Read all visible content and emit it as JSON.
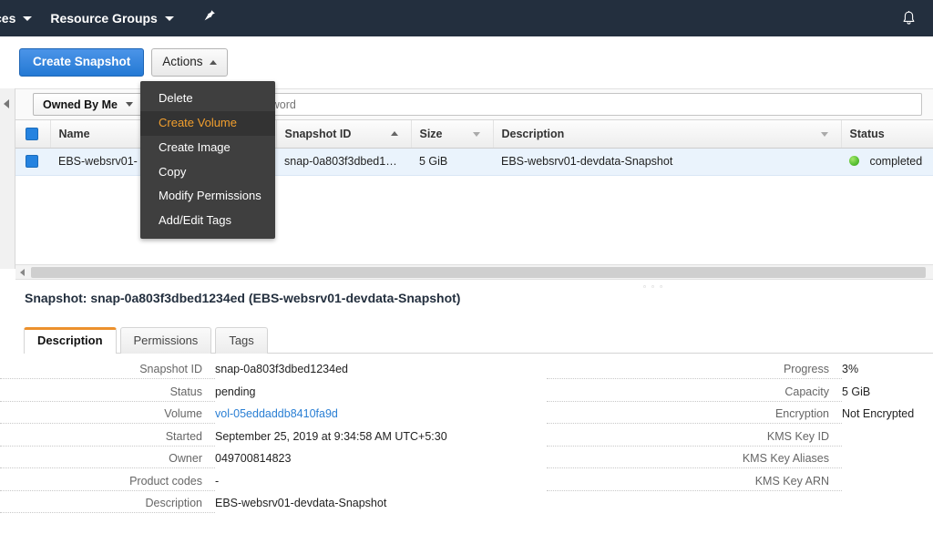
{
  "topnav": {
    "services_label": "ces",
    "resource_groups_label": "Resource Groups",
    "pin_icon": "pin-icon",
    "bell_icon": "bell-icon"
  },
  "toolbar": {
    "create_snapshot_label": "Create Snapshot",
    "actions_label": "Actions"
  },
  "filterbar": {
    "owner_filter_value": "Owned By Me",
    "search_placeholder": "butes or search by keyword"
  },
  "actions_menu": {
    "items": [
      {
        "label": "Delete",
        "highlighted": false
      },
      {
        "label": "Create Volume",
        "highlighted": true
      },
      {
        "label": "Create Image",
        "highlighted": false
      },
      {
        "label": "Copy",
        "highlighted": false
      },
      {
        "label": "Modify Permissions",
        "highlighted": false
      },
      {
        "label": "Add/Edit Tags",
        "highlighted": false
      }
    ]
  },
  "table": {
    "columns": [
      "Name",
      "Snapshot ID",
      "Size",
      "Description",
      "Status"
    ],
    "rows": [
      {
        "name": "EBS-websrv01-",
        "snapshot_id": "snap-0a803f3dbed1…",
        "size": "5 GiB",
        "description": "EBS-websrv01-devdata-Snapshot",
        "status": "completed"
      }
    ]
  },
  "detail": {
    "title": "Snapshot: snap-0a803f3dbed1234ed (EBS-websrv01-devdata-Snapshot)",
    "tabs": [
      {
        "label": "Description",
        "active": true
      },
      {
        "label": "Permissions",
        "active": false
      },
      {
        "label": "Tags",
        "active": false
      }
    ],
    "left_fields": [
      {
        "label": "Snapshot ID",
        "value": "snap-0a803f3dbed1234ed",
        "link": false
      },
      {
        "label": "Status",
        "value": "pending",
        "link": false
      },
      {
        "label": "Volume",
        "value": "vol-05eddaddb8410fa9d",
        "link": true
      },
      {
        "label": "Started",
        "value": "September 25, 2019 at 9:34:58 AM UTC+5:30",
        "link": false
      },
      {
        "label": "Owner",
        "value": "049700814823",
        "link": false
      },
      {
        "label": "Product codes",
        "value": "-",
        "link": false
      },
      {
        "label": "Description",
        "value": "EBS-websrv01-devdata-Snapshot",
        "link": false
      }
    ],
    "right_fields": [
      {
        "label": "Progress",
        "value": "3%"
      },
      {
        "label": "Capacity",
        "value": "5 GiB"
      },
      {
        "label": "Encryption",
        "value": "Not Encrypted"
      },
      {
        "label": "KMS Key ID",
        "value": ""
      },
      {
        "label": "KMS Key Aliases",
        "value": ""
      },
      {
        "label": "KMS Key ARN",
        "value": ""
      }
    ]
  },
  "colors": {
    "nav_bg": "#232f3e",
    "primary_button": "#2479d4",
    "accent_orange": "#ec912d",
    "menu_highlight": "#f29f2e",
    "status_green": "#5bc236",
    "link_blue": "#2a7fd4"
  }
}
